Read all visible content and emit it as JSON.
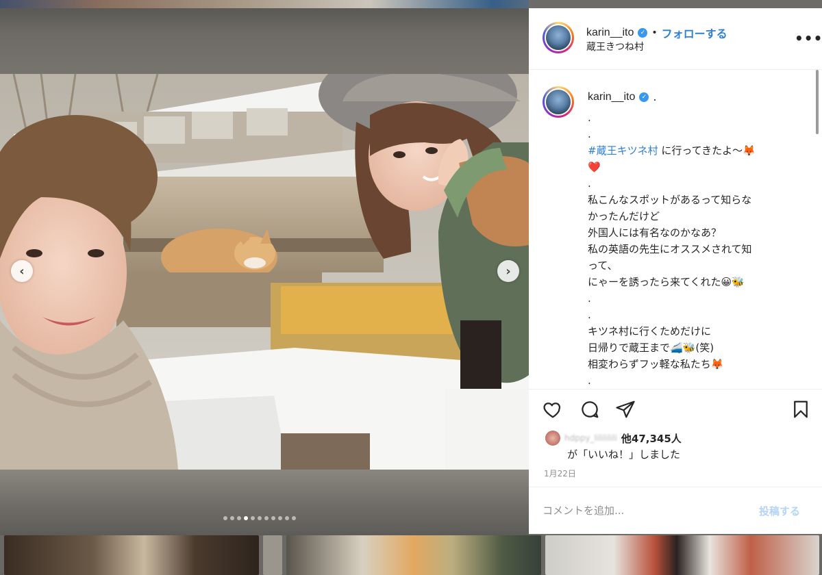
{
  "post": {
    "username": "karin__ito",
    "verified_icon": "verified-badge-icon",
    "separator": "•",
    "follow_label": "フォローする",
    "location": "蔵王きつね村",
    "more_icon": "more-options-icon",
    "more_glyph": "•••",
    "caption": {
      "username": "karin__ito",
      "head_suffix": ".",
      "hashtag": "#蔵王キツネ村",
      "lines": [
        ".",
        ".",
        "に行ってきたよ〜🦊",
        "❤️",
        ".",
        "私こんなスポットがあるって知らな",
        "かったんだけど",
        "外国人には有名なのかなあ？",
        "私の英語の先生にオススメされて知",
        "って、",
        "にゃーを誘ったら来てくれた😀🐝",
        ".",
        ".",
        "キツネ村に行くためだけに",
        "日帰りで蔵王まで🚄🐝(笑)",
        "相変わらずフッ軽な私たち🦊",
        ".",
        "."
      ]
    },
    "actions": {
      "like_icon": "heart-icon",
      "comment_icon": "comment-icon",
      "share_icon": "send-icon",
      "save_icon": "bookmark-icon"
    },
    "likes": {
      "liker_name": "hdppy_lilililili",
      "count_text": "他47,345人",
      "suffix_text": "が「いいね！」しました"
    },
    "date": "1月22日",
    "comment": {
      "placeholder": "コメントを追加...",
      "post_label": "投稿する"
    }
  },
  "carousel": {
    "prev_glyph": "‹",
    "next_glyph": "›",
    "slide_count": 11,
    "active_index": 3
  },
  "colors": {
    "accent": "#2f7fd3",
    "verified": "#3897f0",
    "muted": "#8e8e8e",
    "post_disabled": "#b3d4f5"
  }
}
